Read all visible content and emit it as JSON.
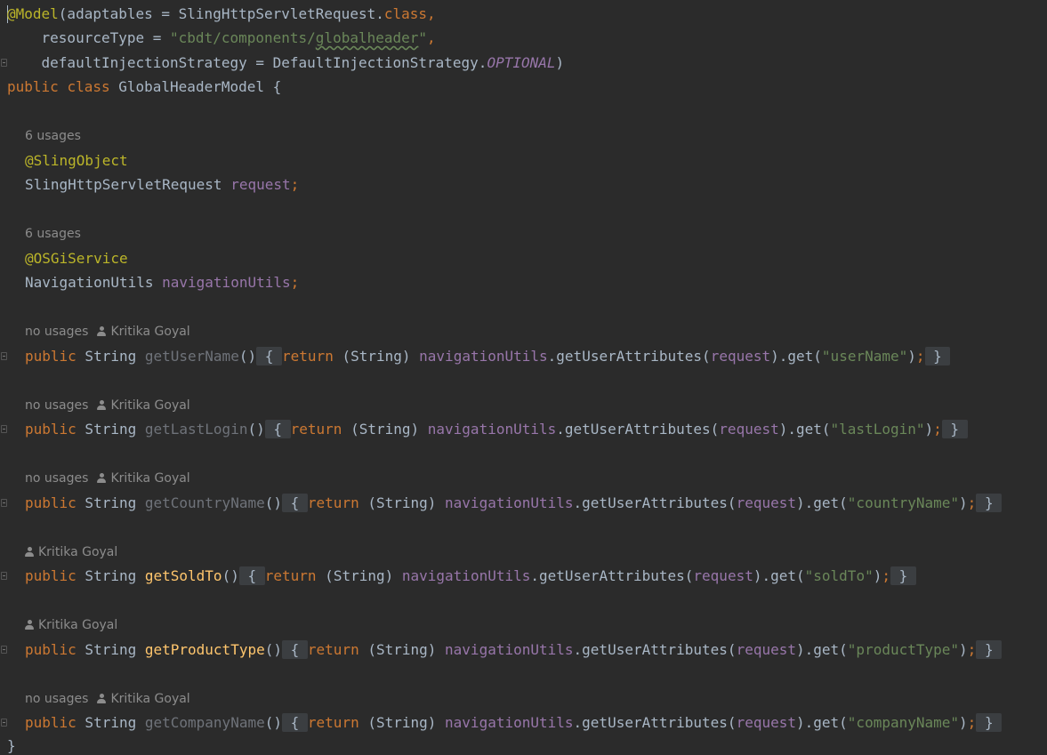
{
  "code": {
    "model_annotation": "@Model",
    "model_args_open": "(adaptables = SlingHttpServletRequest.",
    "class_kw": "class",
    "comma": ",",
    "resource_type_key": "    resourceType = ",
    "resource_type_q1": "\"cbdt/components/",
    "resource_type_squiggle": "globalheader",
    "resource_type_q2": "\"",
    "resource_type_comma": ",",
    "default_injection_key": "    defaultInjectionStrategy = DefaultInjectionStrategy.",
    "optional_const": "OPTIONAL",
    "close_paren": ")",
    "public_kw": "public",
    "class_decl_kw": "class",
    "class_name": " GlobalHeaderModel {",
    "field1_annotation": "@SlingObject",
    "field1_type": "SlingHttpServletRequest ",
    "field1_name": "request",
    "field2_annotation": "@OSGiService",
    "field2_type": "NavigationUtils ",
    "field2_name": "navigationUtils",
    "semicolon": ";",
    "closing_brace": "}",
    "string_type": " String ",
    "return_kw": "return",
    "string_cast": " (String) ",
    "nav_field": "navigationUtils",
    "get_user_attrs": ".getUserAttributes(",
    "request_field": "request",
    "get_call": ").get(",
    "close_call": ")",
    "fold_open": "{",
    "fold_close": "}"
  },
  "hints": {
    "usages_6": "6 usages",
    "no_usages": "no usages",
    "author": "Kritika Goyal"
  },
  "methods": [
    {
      "name": "getUserName",
      "key": "\"userName\"",
      "used": false
    },
    {
      "name": "getLastLogin",
      "key": "\"lastLogin\"",
      "used": false
    },
    {
      "name": "getCountryName",
      "key": "\"countryName\"",
      "used": false
    },
    {
      "name": "getSoldTo",
      "key": "\"soldTo\"",
      "used": true
    },
    {
      "name": "getProductType",
      "key": "\"productType\"",
      "used": true
    },
    {
      "name": "getCompanyName",
      "key": "\"companyName\"",
      "used": false
    }
  ],
  "colors": {
    "background": "#2b2b2b",
    "keyword": "#cc7832",
    "annotation": "#bbb529",
    "string": "#6a8759",
    "field": "#9876aa",
    "text": "#a9b7c6",
    "method_used": "#ffc66d",
    "method_unused": "#6f737a"
  }
}
